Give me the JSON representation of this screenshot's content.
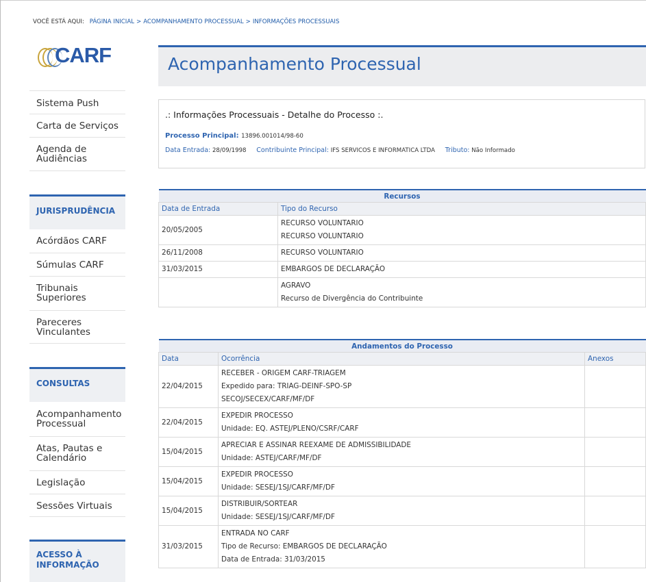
{
  "breadcrumb": {
    "label": "VOCÊ ESTÁ AQUI:",
    "items": [
      "PÁGINA INICIAL",
      "ACOMPANHAMENTO PROCESSUAL",
      "INFORMAÇÕES PROCESSUAIS"
    ],
    "separator": ">"
  },
  "logo": {
    "text": "CARF"
  },
  "sidebar": {
    "top_items": [
      "Sistema Push",
      "Carta de Serviços",
      "Agenda de Audiências"
    ],
    "sections": [
      {
        "title": "JURISPRUDÊNCIA",
        "items": [
          "Acórdãos CARF",
          "Súmulas CARF",
          "Tribunais Superiores",
          "Pareceres Vinculantes"
        ]
      },
      {
        "title": "CONSULTAS",
        "items": [
          "Acompanhamento Processual",
          "Atas, Pautas e Calendário",
          "Legislação",
          "Sessões Virtuais"
        ]
      },
      {
        "title": "ACESSO À INFORMAÇÃO",
        "items": []
      }
    ]
  },
  "page": {
    "title": "Acompanhamento Processual"
  },
  "info": {
    "title": ".: Informações Processuais - Detalhe do Processo :.",
    "processo_label": "Processo Principal:",
    "processo_value": "13896.001014/98-60",
    "entrada_label": "Data Entrada:",
    "entrada_value": "28/09/1998",
    "contribuinte_label": "Contribuinte Principal:",
    "contribuinte_value": "IFS SERVICOS E INFORMATICA LTDA",
    "tributo_label": "Tributo:",
    "tributo_value": "Não Informado"
  },
  "recursos": {
    "title": "Recursos",
    "headers": [
      "Data de Entrada",
      "Tipo do Recurso"
    ],
    "rows": [
      {
        "date": "20/05/2005",
        "lines": [
          "RECURSO VOLUNTARIO",
          "RECURSO VOLUNTARIO"
        ]
      },
      {
        "date": "26/11/2008",
        "lines": [
          "RECURSO VOLUNTARIO"
        ]
      },
      {
        "date": "31/03/2015",
        "lines": [
          "EMBARGOS DE DECLARAÇÃO"
        ]
      },
      {
        "date": "",
        "lines": [
          "AGRAVO",
          "Recurso de Divergência do Contribuinte"
        ]
      }
    ]
  },
  "andamentos": {
    "title": "Andamentos do Processo",
    "headers": [
      "Data",
      "Ocorrência",
      "Anexos"
    ],
    "rows": [
      {
        "date": "22/04/2015",
        "lines": [
          "RECEBER - ORIGEM CARF-TRIAGEM",
          "Expedido para: TRIAG-DEINF-SPO-SP",
          "SECOJ/SECEX/CARF/MF/DF"
        ]
      },
      {
        "date": "22/04/2015",
        "lines": [
          "EXPEDIR PROCESSO",
          "Unidade: EQ. ASTEJ/PLENO/CSRF/CARF"
        ]
      },
      {
        "date": "15/04/2015",
        "lines": [
          "APRECIAR E ASSINAR REEXAME DE ADMISSIBILIDADE",
          "Unidade: ASTEJ/CARF/MF/DF"
        ]
      },
      {
        "date": "15/04/2015",
        "lines": [
          "EXPEDIR PROCESSO",
          "Unidade: SESEJ/1SJ/CARF/MF/DF"
        ]
      },
      {
        "date": "15/04/2015",
        "lines": [
          "DISTRIBUIR/SORTEAR",
          "Unidade: SESEJ/1SJ/CARF/MF/DF"
        ]
      },
      {
        "date": "31/03/2015",
        "lines": [
          "ENTRADA NO CARF",
          "Tipo de Recurso: EMBARGOS DE DECLARAÇÃO",
          "Data de Entrada: 31/03/2015"
        ]
      }
    ]
  },
  "colors": {
    "accent": "#2e64b0",
    "header_bg": "#ecedef",
    "table_head_bg": "#eef0f4"
  }
}
